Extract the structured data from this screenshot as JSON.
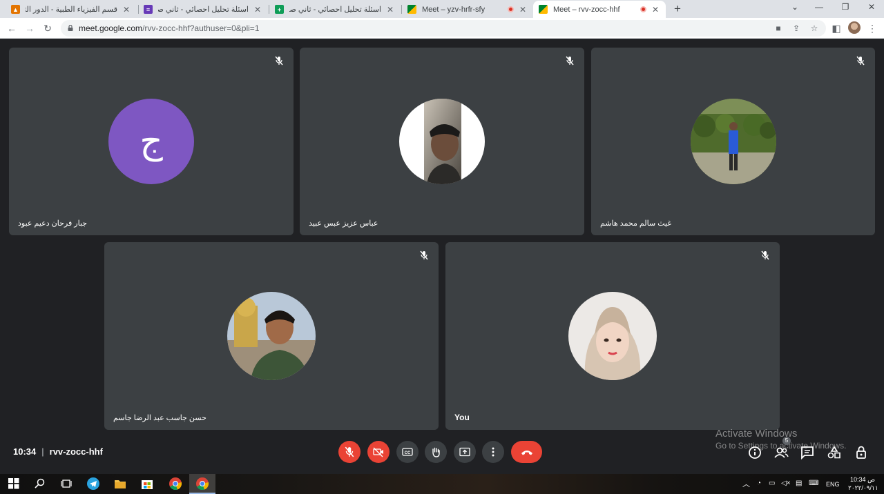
{
  "browser": {
    "tabs": [
      {
        "title": "قسم الفيزياء الطبية - الدور الثاني ا.",
        "favicon_color": "#e37400",
        "active": false,
        "recording": false
      },
      {
        "title": "اسئلة تحليل احصائي - ثاني صباحي",
        "favicon_color": "#673ab7",
        "active": false,
        "recording": false
      },
      {
        "title": "اسئلة تحليل احصائي - ثاني صباحي",
        "favicon_color": "#0f9d58",
        "active": false,
        "recording": false
      },
      {
        "title": "Meet – yzv-hrfr-sfy",
        "favicon_color": "#00832d",
        "active": false,
        "recording": true
      },
      {
        "title": "Meet – rvv-zocc-hhf",
        "favicon_color": "#00832d",
        "active": true,
        "recording": true
      }
    ],
    "url_host": "meet.google.com",
    "url_path": "/rvv-zocc-hhf?authuser=0&pli=1"
  },
  "participants": [
    {
      "name": "جبار فرحان دعيم عبود",
      "avatar": "initial",
      "initial": "ج"
    },
    {
      "name": "عباس عزيز عبس عبيد",
      "avatar": "photo"
    },
    {
      "name": "غيث سالم محمد هاشم",
      "avatar": "photo"
    },
    {
      "name": "حسن جاسب عبد الرضا جاسم",
      "avatar": "photo"
    },
    {
      "name": "You",
      "avatar": "photo"
    }
  ],
  "meeting": {
    "time": "10:34",
    "code": "rvv-zocc-hhf",
    "participant_count": "5"
  },
  "controls": [
    "mic-off",
    "camera-off",
    "captions",
    "raise-hand",
    "present",
    "more-options",
    "leave-call"
  ],
  "right_controls": [
    "info",
    "people",
    "chat",
    "activities",
    "host-controls"
  ],
  "watermark": {
    "line1": "Activate Windows",
    "line2": "Go to Settings to activate Windows."
  },
  "taskbar": {
    "lang": "ENG",
    "time": "10:34 ص",
    "date": "٢٠٢٢/٠٩/١١"
  }
}
